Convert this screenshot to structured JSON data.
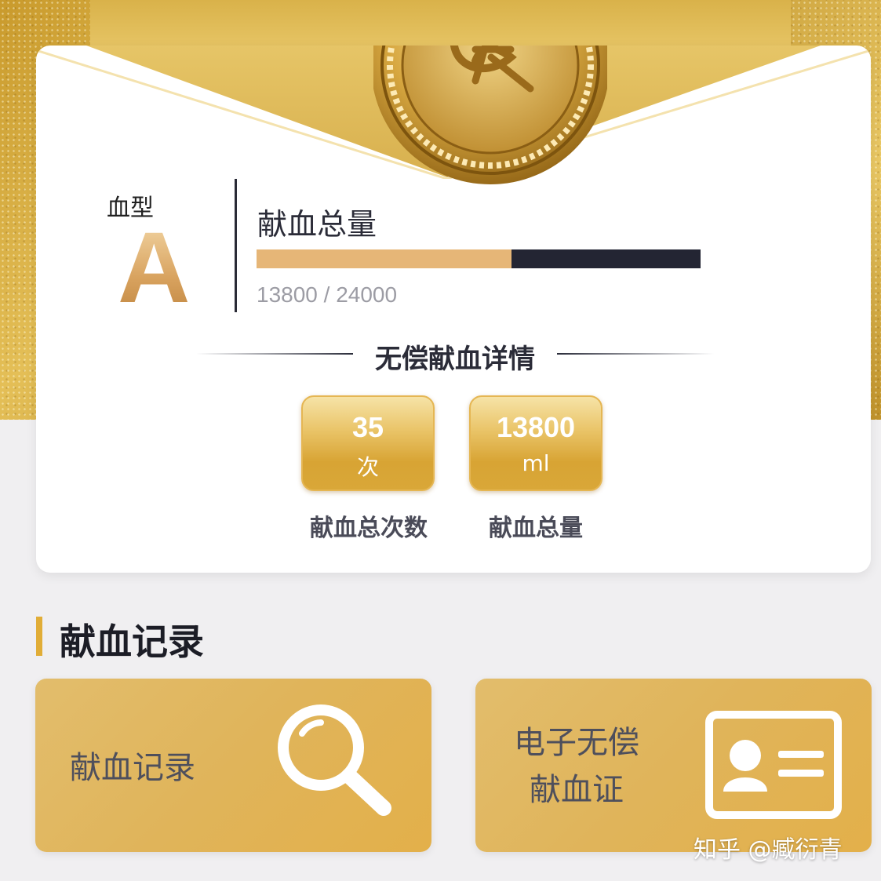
{
  "blood_type": {
    "label": "血型",
    "value": "A"
  },
  "donation_total": {
    "title": "献血总量",
    "current": 13800,
    "target": 24000,
    "progress_text": "13800 / 24000",
    "progress_fraction": 0.575
  },
  "details": {
    "section_title": "无偿献血详情",
    "stats": [
      {
        "value": "35",
        "unit": "次",
        "label": "献血总次数"
      },
      {
        "value": "13800",
        "unit": "ml",
        "label": "献血总量"
      }
    ]
  },
  "records": {
    "title": "献血记录",
    "tiles": [
      {
        "label": "献血记录",
        "icon": "magnifier-icon"
      },
      {
        "label_line1": "电子无偿",
        "label_line2": "献血证",
        "icon": "id-card-icon"
      }
    ]
  },
  "watermark": "知乎 @臧衍青",
  "colors": {
    "gold": "#e1ad37",
    "progress_fill": "#e6b677",
    "progress_track": "#232533"
  }
}
